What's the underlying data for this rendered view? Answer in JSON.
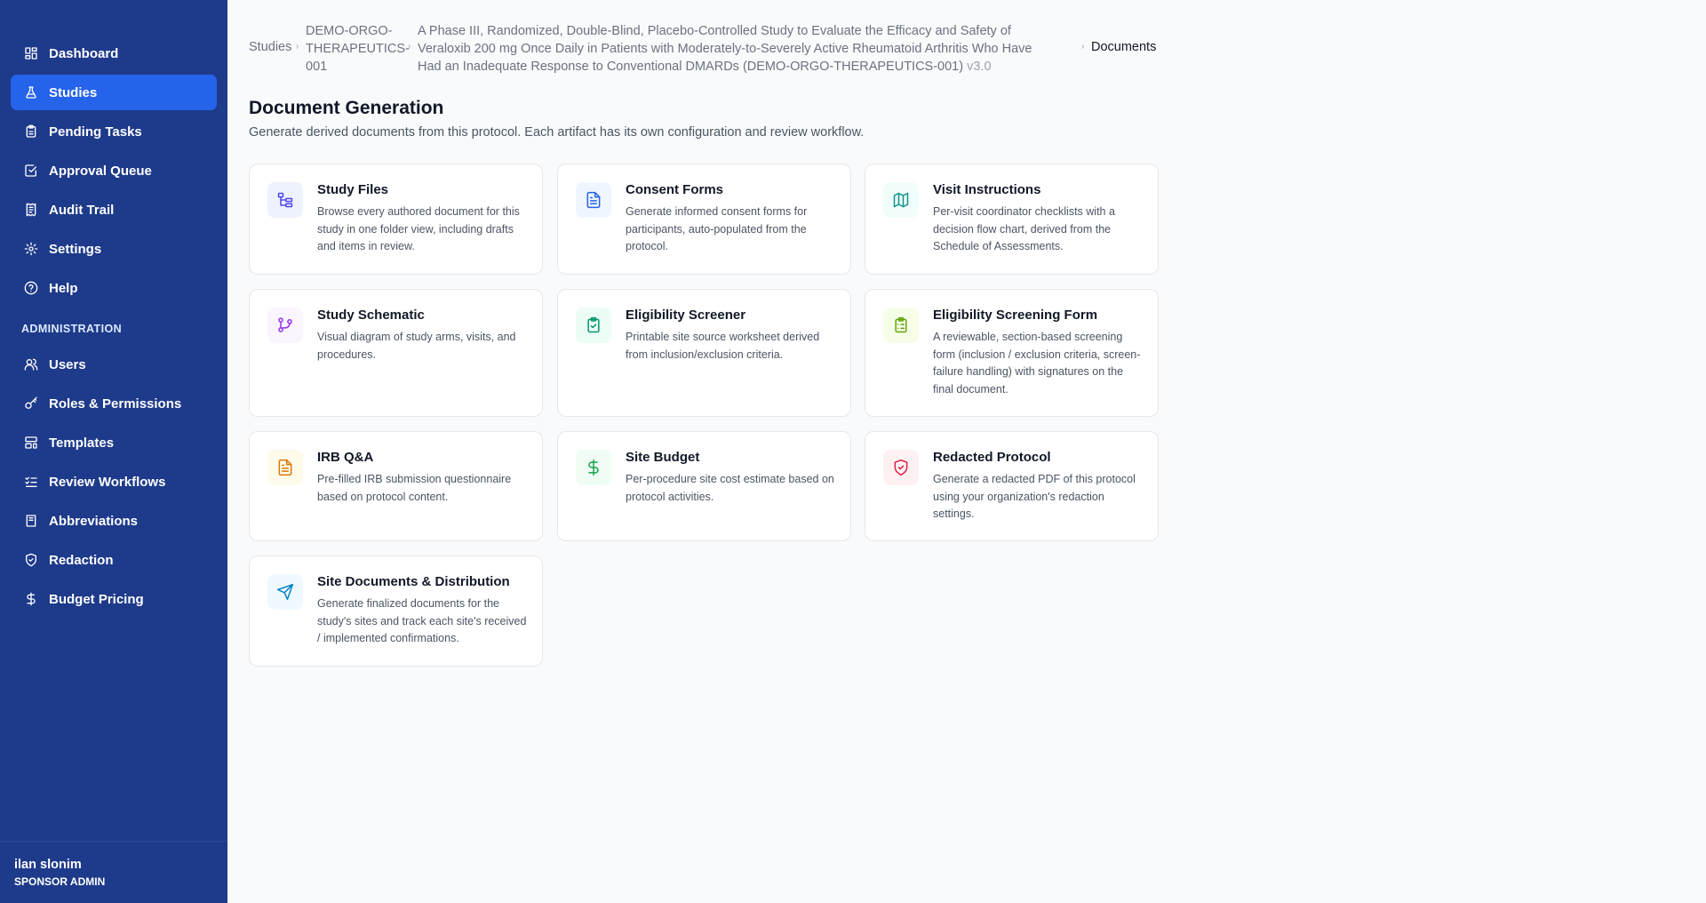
{
  "sidebar": {
    "items": [
      {
        "label": "Dashboard",
        "icon": "dashboard-icon"
      },
      {
        "label": "Studies",
        "icon": "flask-icon",
        "active": true
      },
      {
        "label": "Pending Tasks",
        "icon": "clipboard-icon"
      },
      {
        "label": "Approval Queue",
        "icon": "check-square-icon"
      },
      {
        "label": "Audit Trail",
        "icon": "receipt-icon"
      },
      {
        "label": "Settings",
        "icon": "gear-icon"
      },
      {
        "label": "Help",
        "icon": "help-circle-icon"
      }
    ],
    "admin_section_label": "ADMINISTRATION",
    "admin_items": [
      {
        "label": "Users",
        "icon": "users-icon"
      },
      {
        "label": "Roles & Permissions",
        "icon": "key-icon"
      },
      {
        "label": "Templates",
        "icon": "layout-template-icon"
      },
      {
        "label": "Review Workflows",
        "icon": "list-checks-icon"
      },
      {
        "label": "Abbreviations",
        "icon": "book-icon"
      },
      {
        "label": "Redaction",
        "icon": "shield-icon"
      },
      {
        "label": "Budget Pricing",
        "icon": "dollar-icon"
      }
    ],
    "user": {
      "name": "ilan slonim",
      "role": "SPONSOR ADMIN"
    }
  },
  "breadcrumb": {
    "studies": "Studies",
    "study_id": "DEMO-ORGO-THERAPEUTICS-001",
    "protocol_title": "A Phase III, Randomized, Double-Blind, Placebo-Controlled Study to Evaluate the Efficacy and Safety of Veraloxib 200 mg Once Daily in Patients with Moderately-to-Severely Active Rheumatoid Arthritis Who Have Had an Inadequate Response to Conventional DMARDs (DEMO-ORGO-THERAPEUTICS-001)",
    "version": "v3.0",
    "current": "Documents"
  },
  "page": {
    "title": "Document Generation",
    "subtitle": "Generate derived documents from this protocol. Each artifact has its own configuration and review workflow."
  },
  "cards": [
    {
      "title": "Study Files",
      "description": "Browse every authored document for this study in one folder view, including drafts and items in review.",
      "icon": "folder-tree-icon",
      "color": "#4f46e5",
      "bg": "#eef2ff"
    },
    {
      "title": "Consent Forms",
      "description": "Generate informed consent forms for participants, auto-populated from the protocol.",
      "icon": "file-text-icon",
      "color": "#2563eb",
      "bg": "#eff6ff"
    },
    {
      "title": "Visit Instructions",
      "description": "Per-visit coordinator checklists with a decision flow chart, derived from the Schedule of Assessments.",
      "icon": "map-icon",
      "color": "#0d9488",
      "bg": "#f0fdfa"
    },
    {
      "title": "Study Schematic",
      "description": "Visual diagram of study arms, visits, and procedures.",
      "icon": "git-branch-icon",
      "color": "#9333ea",
      "bg": "#faf5ff"
    },
    {
      "title": "Eligibility Screener",
      "description": "Printable site source worksheet derived from inclusion/exclusion criteria.",
      "icon": "clipboard-check-icon",
      "color": "#059669",
      "bg": "#ecfdf5"
    },
    {
      "title": "Eligibility Screening Form",
      "description": "A reviewable, section-based screening form (inclusion / exclusion criteria, screen-failure handling) with signatures on the final document.",
      "icon": "clipboard-list-icon",
      "color": "#65a30d",
      "bg": "#f7fee7"
    },
    {
      "title": "IRB Q&A",
      "description": "Pre-filled IRB submission questionnaire based on protocol content.",
      "icon": "file-lines-icon",
      "color": "#d97706",
      "bg": "#fffbeb"
    },
    {
      "title": "Site Budget",
      "description": "Per-procedure site cost estimate based on protocol activities.",
      "icon": "dollar-icon",
      "color": "#16a34a",
      "bg": "#f0fdf4"
    },
    {
      "title": "Redacted Protocol",
      "description": "Generate a redacted PDF of this protocol using your organization's redaction settings.",
      "icon": "shield-check-icon",
      "color": "#e11d48",
      "bg": "#fff1f2"
    },
    {
      "title": "Site Documents & Distribution",
      "description": "Generate finalized documents for the study's sites and track each site's received / implemented confirmations.",
      "icon": "send-icon",
      "color": "#0284c7",
      "bg": "#f0f9ff"
    }
  ]
}
